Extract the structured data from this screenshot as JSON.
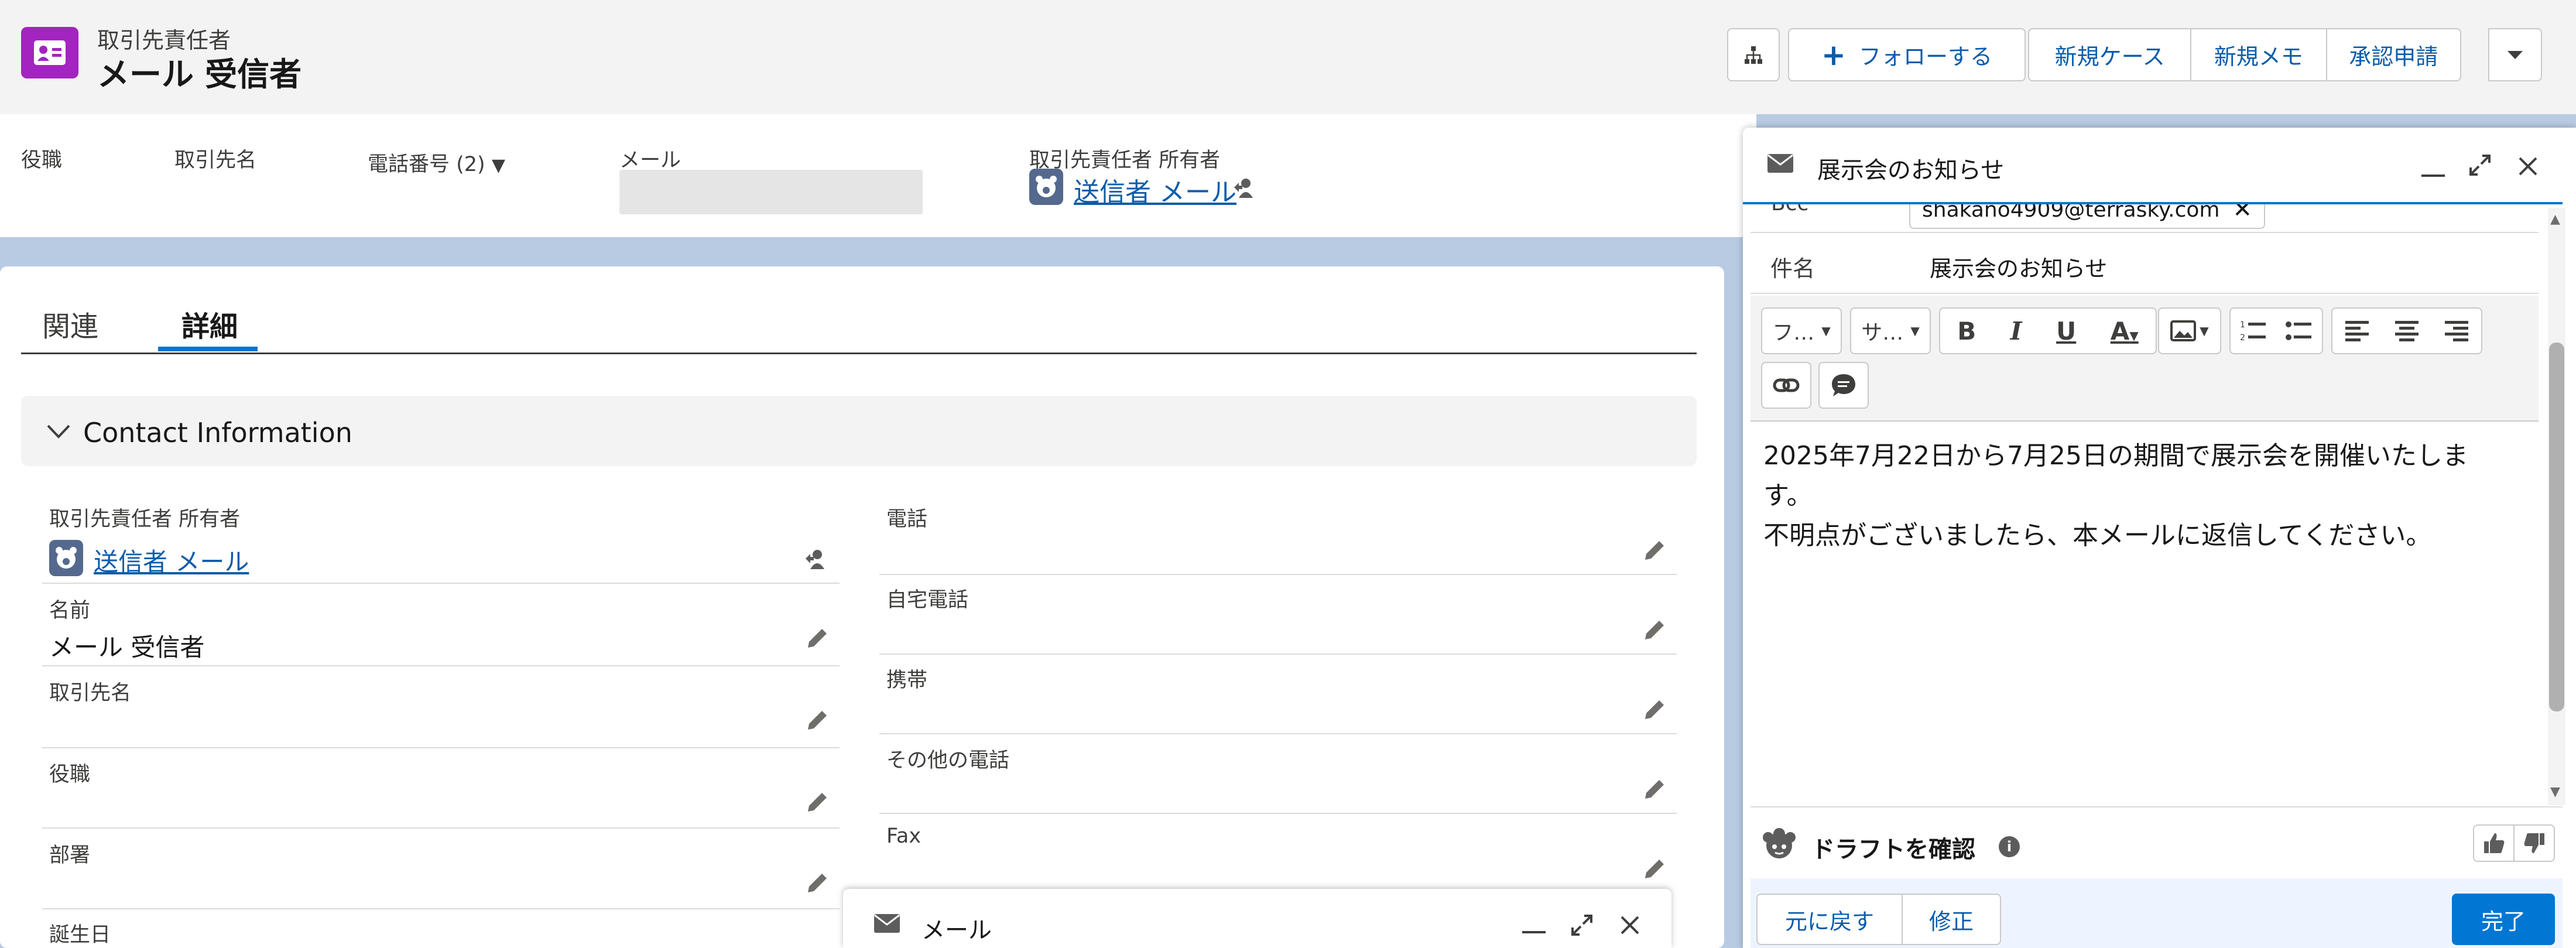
{
  "header": {
    "object_type": "取引先責任者",
    "record_name": "メール 受信者",
    "actions": [
      "フォローする",
      "新規ケース",
      "新規メモ",
      "承認申請"
    ]
  },
  "highlights": {
    "title": "役職",
    "account": "取引先名",
    "phone": "電話番号 (2)",
    "email": "メール",
    "owner_label": "取引先責任者 所有者",
    "owner_value": "送信者 メール"
  },
  "tabs": [
    "関連",
    "詳細"
  ],
  "section": {
    "title": "Contact Information"
  },
  "fields_left": [
    {
      "label": "取引先責任者 所有者",
      "value": "送信者 メール"
    },
    {
      "label": "名前",
      "value": "メール 受信者"
    },
    {
      "label": "取引先名",
      "value": ""
    },
    {
      "label": "役職",
      "value": ""
    },
    {
      "label": "部署",
      "value": ""
    },
    {
      "label": "誕生日",
      "value": ""
    }
  ],
  "fields_right": [
    {
      "label": "電話",
      "value": ""
    },
    {
      "label": "自宅電話",
      "value": ""
    },
    {
      "label": "携帯",
      "value": ""
    },
    {
      "label": "その他の電話",
      "value": ""
    },
    {
      "label": "Fax",
      "value": ""
    }
  ],
  "mini_mail": {
    "title": "メール"
  },
  "email": {
    "title": "展示会のお知らせ",
    "bcc_label": "Bcc",
    "bcc_value": "shakano4909@terrasky.com",
    "subject_label": "件名",
    "subject_value": "展示会のお知らせ",
    "font_label": "フ…",
    "size_label": "サ…",
    "body_line1": "2025年7月22日から7月25日の期間で展示会を開催いたしま",
    "body_line2": "す。",
    "body_line3": "不明点がございましたら、本メールに返信してください。",
    "draft_label": "ドラフトを確認",
    "undo": "元に戻す",
    "modify": "修正",
    "done": "完了"
  },
  "colors": {
    "accent": "#0b5cab",
    "brand_icon": "#a324c0",
    "done_button": "#0176d3"
  }
}
